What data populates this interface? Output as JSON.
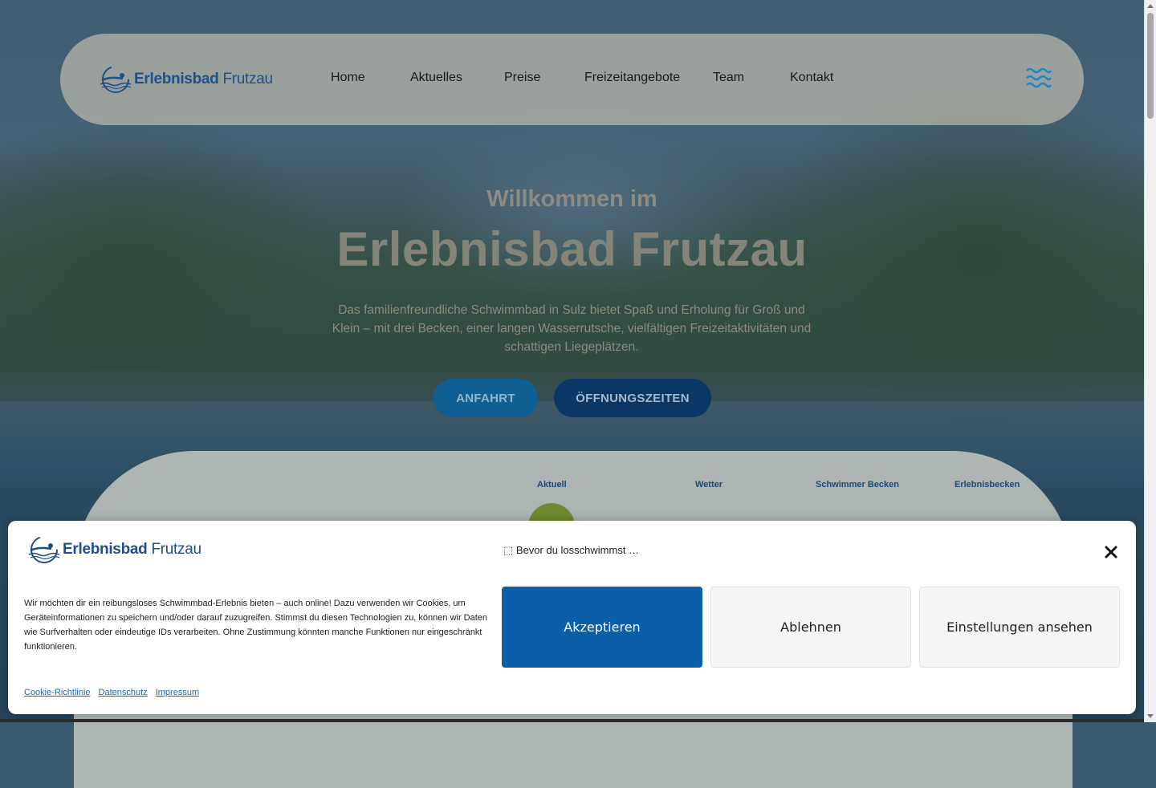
{
  "brand": {
    "name_bold": "Erlebnisbad",
    "name_light": "Frutzau",
    "primary_color": "#1f4f88",
    "accent_color": "#0b5ea8"
  },
  "nav": {
    "items": [
      {
        "label": "Home"
      },
      {
        "label": "Aktuelles"
      },
      {
        "label": "Preise"
      },
      {
        "label": "Freizeitangebote"
      },
      {
        "label": "Team"
      },
      {
        "label": "Kontakt"
      }
    ],
    "menu_icon": "waves-menu-icon"
  },
  "hero": {
    "pre_title": "Willkommen im",
    "title": "Erlebnisbad Frutzau",
    "description": "Das familienfreundliche Schwimmbad in Sulz bietet Spaß und Erholung für Groß und Klein – mit drei Becken, einer langen Wasserrutsche, vielfältigen Freizeitaktivitäten und schattigen Liegeplätzen.",
    "buttons": {
      "directions": "ANFAHRT",
      "opening_hours": "ÖFFNUNGSZEITEN"
    }
  },
  "status_panel": {
    "labels": [
      "Aktuell",
      "Wetter",
      "Schwimmer Becken",
      "Erlebnisbecken"
    ],
    "status_color": "#6f8a2e"
  },
  "cookie_banner": {
    "title": "⬚ Bevor du losschwimmst …",
    "text": "Wir möchten dir ein reibungsloses Schwimmbad-Erlebnis bieten – auch online! Dazu verwenden wir Cookies, um Geräteinformationen zu speichern und/oder darauf zuzugreifen. Stimmst du diesen Technologien zu, können wir Daten wie Surfverhalten oder eindeutige IDs verarbeiten. Ohne Zustimmung könnten manche Funktionen nur eingeschränkt funktionieren.",
    "accept_label": "Akzeptieren",
    "deny_label": "Ablehnen",
    "settings_label": "Einstellungen ansehen",
    "links": [
      "Cookie-Richtlinie",
      "Datenschutz",
      "Impressum"
    ]
  }
}
